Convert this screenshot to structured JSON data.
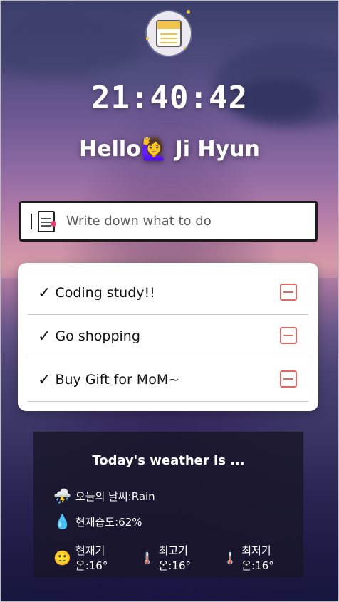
{
  "clock": {
    "time": "21:40:42"
  },
  "greeting": {
    "prefix": "Hello",
    "emoji": "🙋‍♀️",
    "name": "Ji Hyun"
  },
  "todo_input": {
    "placeholder": "Write down what to do"
  },
  "todos": [
    {
      "check": "✓",
      "text": "Coding study!!"
    },
    {
      "check": "✓",
      "text": "Go shopping"
    },
    {
      "check": "✓",
      "text": "Buy Gift for MoM~"
    }
  ],
  "weather": {
    "title": "Today's weather is ...",
    "condition_icon": "⛈️",
    "condition": "오늘의 날씨:Rain",
    "humidity_icon": "💧",
    "humidity": "현재습도:62%",
    "temp_icon": "🙂",
    "current_temp": "현재기온:16°",
    "thermo1": "🌡️",
    "max_temp": "최고기온:16°",
    "thermo2": "🌡️",
    "min_temp": "최저기온:16°"
  },
  "colors": {
    "remove": "#e06a63",
    "icon_yellow": "#f2c34a",
    "note_pink": "#e0457b"
  }
}
